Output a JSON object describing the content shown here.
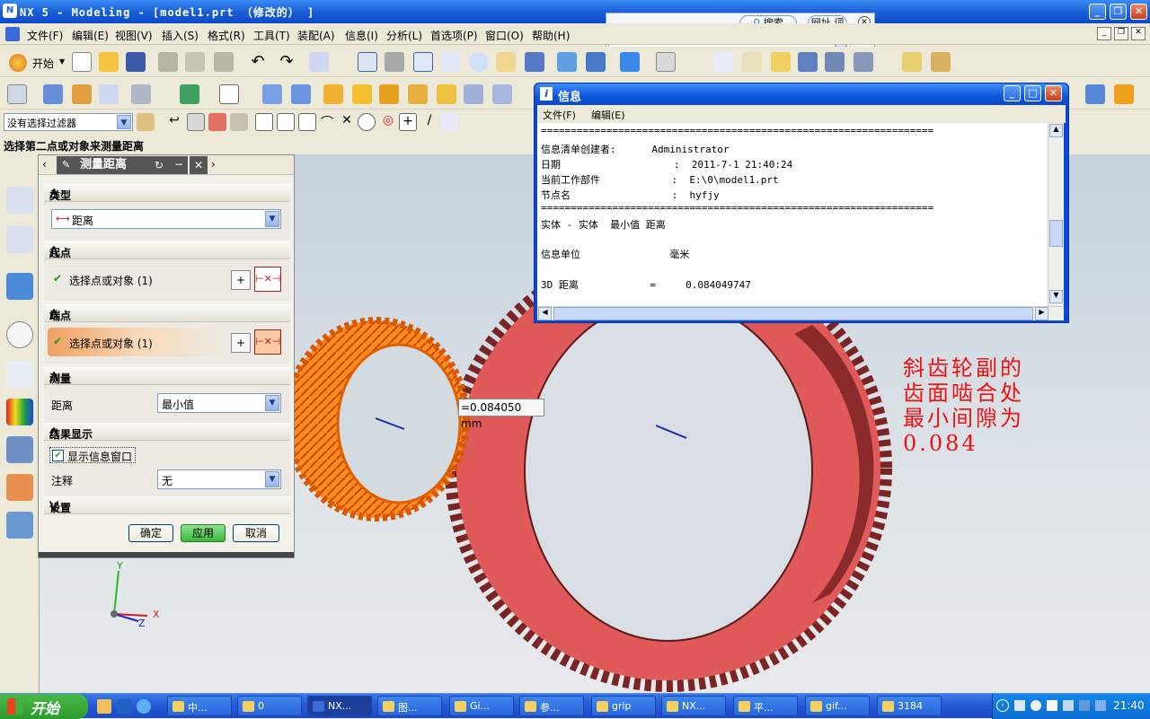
{
  "window": {
    "title": "NX 5 - Modeling - [model1.prt （修改的） ]"
  },
  "search_bar": {
    "search_label": "搜索",
    "url_label": "网址",
    "word_label": "词"
  },
  "menu": [
    "文件(F)",
    "编辑(E)",
    "视图(V)",
    "插入(S)",
    "格式(R)",
    "工具(T)",
    "装配(A)",
    "信息(I)",
    "分析(L)",
    "首选项(P)",
    "窗口(O)",
    "帮助(H)"
  ],
  "toolbar": {
    "start_label": "开始"
  },
  "filter": {
    "value": "没有选择过滤器"
  },
  "prompt": {
    "text": "选择第二点或对象来测量距离"
  },
  "dialog": {
    "title": "测量距离",
    "type_section": "类型",
    "type_value": "距离",
    "start_section": "起点",
    "start_select": "选择点或对象 (1)",
    "end_section": "端点",
    "end_select": "选择点或对象 (1)",
    "measure_section": "测量",
    "distance_label": "距离",
    "distance_value": "最小值",
    "result_section": "结果显示",
    "show_info_label": "显示信息窗口",
    "show_info_checked": true,
    "annotation_label": "注释",
    "annotation_value": "无",
    "settings_section": "设置",
    "ok_label": "确定",
    "apply_label": "应用",
    "cancel_label": "取消"
  },
  "info_window": {
    "title": "信息",
    "menu_file": "文件(F)",
    "menu_edit": "编辑(E)",
    "lines": [
      "==================================================================",
      "信息清单创建者:      Administrator",
      "日期                   :  2011-7-1 21:40:24",
      "当前工作部件            :  E:\\0\\model1.prt",
      "节点名                 :  hyfjy",
      "==================================================================",
      "实体 - 实体  最小值 距离",
      "",
      "信息单位               毫米",
      "",
      "3D 距离            =     0.084049747"
    ]
  },
  "viewport": {
    "measurement_label": "=0.084050 mm",
    "annotation_lines": [
      "斜齿轮副的",
      "齿面啮合处",
      "最小间隙为",
      "0.084"
    ],
    "axis_x": "X",
    "axis_y": "Y",
    "axis_z": "Z",
    "gear_color_small": "#ff7a10",
    "gear_color_large": "#e35a5a",
    "annotation_color": "#ee1111"
  },
  "taskbar": {
    "start_label": "开始",
    "tasks": [
      "中...",
      "0",
      "NX...",
      "图...",
      "Gi...",
      "参...",
      "grip",
      "NX...",
      "平...",
      "gif...",
      "3184"
    ],
    "clock": "21:40"
  }
}
